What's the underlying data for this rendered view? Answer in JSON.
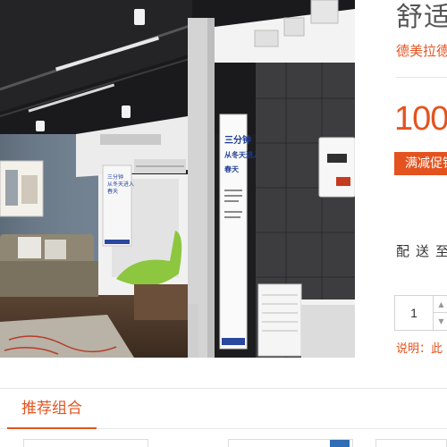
{
  "product": {
    "title": "舒适",
    "brand": "德美拉德",
    "price": "100",
    "promo_label": "满减促销",
    "ship_to_label": "配送至",
    "quantity": "1",
    "note": "说明：此"
  },
  "poster": {
    "line1": "三分钟",
    "line2": "从冬天进入",
    "line3": "春天",
    "small_line1": "三分钟",
    "small_line2": "从冬天进入",
    "small_line3": "春天"
  },
  "recommend": {
    "tab_label": "推荐组合"
  },
  "colors": {
    "accent": "#e4531f",
    "badge_blue": "#2f6db5"
  },
  "icons": {
    "qty_up": "▲",
    "qty_down": "▼"
  }
}
